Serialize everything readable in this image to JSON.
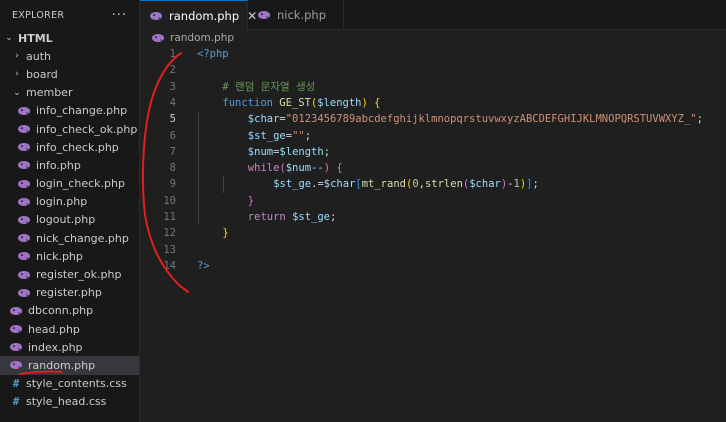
{
  "explorer": {
    "title": "EXPLORER",
    "more_label": "···"
  },
  "tree": [
    {
      "label": "HTML",
      "type": "root-folder",
      "chevron": "⌄"
    },
    {
      "label": "auth",
      "type": "folder",
      "chevron": "›"
    },
    {
      "label": "board",
      "type": "folder",
      "chevron": "›"
    },
    {
      "label": "member",
      "type": "folder",
      "chevron": "⌄"
    },
    {
      "label": "info_change.php",
      "type": "php"
    },
    {
      "label": "info_check_ok.php",
      "type": "php"
    },
    {
      "label": "info_check.php",
      "type": "php"
    },
    {
      "label": "info.php",
      "type": "php"
    },
    {
      "label": "login_check.php",
      "type": "php"
    },
    {
      "label": "login.php",
      "type": "php"
    },
    {
      "label": "logout.php",
      "type": "php"
    },
    {
      "label": "nick_change.php",
      "type": "php"
    },
    {
      "label": "nick.php",
      "type": "php"
    },
    {
      "label": "register_ok.php",
      "type": "php"
    },
    {
      "label": "register.php",
      "type": "php"
    },
    {
      "label": "dbconn.php",
      "type": "php"
    },
    {
      "label": "head.php",
      "type": "php"
    },
    {
      "label": "index.php",
      "type": "php"
    },
    {
      "label": "random.php",
      "type": "php",
      "selected": true
    },
    {
      "label": "style_contents.css",
      "type": "css"
    },
    {
      "label": "style_head.css",
      "type": "css"
    }
  ],
  "tabs": [
    {
      "label": "random.php",
      "active": true,
      "close": "✕"
    },
    {
      "label": "nick.php",
      "active": false
    }
  ],
  "breadcrumb": {
    "file": "random.php"
  },
  "editor": {
    "current_line": 5,
    "lines": [
      {
        "n": "1",
        "indent": 0,
        "tokens": [
          [
            "tag",
            "<?php"
          ]
        ]
      },
      {
        "n": "2",
        "indent": 0,
        "tokens": []
      },
      {
        "n": "3",
        "indent": 1,
        "tokens": [
          [
            "cm",
            "# 랜덤 문자열 생성"
          ]
        ]
      },
      {
        "n": "4",
        "indent": 1,
        "tokens": [
          [
            "kw",
            "function "
          ],
          [
            "fn",
            "GE_ST"
          ],
          [
            "b1",
            "("
          ],
          [
            "var",
            "$length"
          ],
          [
            "b1",
            ")"
          ],
          [
            "pn",
            " "
          ],
          [
            "b1",
            "{"
          ]
        ]
      },
      {
        "n": "5",
        "indent": 2,
        "tokens": [
          [
            "var",
            "$char"
          ],
          [
            "pn",
            "="
          ],
          [
            "str",
            "\"0123456789abcdefghijklmnopqrstuvwxyzABCDEFGHIJKLMNOPQRSTUVWXYZ_\""
          ],
          [
            "pn",
            ";"
          ]
        ]
      },
      {
        "n": "6",
        "indent": 2,
        "tokens": [
          [
            "var",
            "$st_ge"
          ],
          [
            "pn",
            "="
          ],
          [
            "str",
            "\"\""
          ],
          [
            "pn",
            ";"
          ]
        ]
      },
      {
        "n": "7",
        "indent": 2,
        "tokens": [
          [
            "var",
            "$num"
          ],
          [
            "pn",
            "="
          ],
          [
            "var",
            "$length"
          ],
          [
            "pn",
            ";"
          ]
        ]
      },
      {
        "n": "8",
        "indent": 2,
        "tokens": [
          [
            "ctrl",
            "while"
          ],
          [
            "b2",
            "("
          ],
          [
            "var",
            "$num"
          ],
          [
            "pn",
            "--"
          ],
          [
            "b2",
            ")"
          ],
          [
            "pn",
            " "
          ],
          [
            "b2",
            "{"
          ]
        ]
      },
      {
        "n": "9",
        "indent": 3,
        "tokens": [
          [
            "var",
            "$st_ge"
          ],
          [
            "pn",
            ".="
          ],
          [
            "var",
            "$char"
          ],
          [
            "b3",
            "["
          ],
          [
            "fn",
            "mt_rand"
          ],
          [
            "b1",
            "("
          ],
          [
            "num",
            "0"
          ],
          [
            "pn",
            ","
          ],
          [
            "fn",
            "strlen"
          ],
          [
            "b2",
            "("
          ],
          [
            "var",
            "$char"
          ],
          [
            "b2",
            ")"
          ],
          [
            "pn",
            "-"
          ],
          [
            "num",
            "1"
          ],
          [
            "b1",
            ")"
          ],
          [
            "b3",
            "]"
          ],
          [
            "pn",
            ";"
          ]
        ]
      },
      {
        "n": "10",
        "indent": 2,
        "tokens": [
          [
            "b2",
            "}"
          ]
        ]
      },
      {
        "n": "11",
        "indent": 2,
        "tokens": [
          [
            "ctrl",
            "return "
          ],
          [
            "var",
            "$st_ge"
          ],
          [
            "pn",
            ";"
          ]
        ]
      },
      {
        "n": "12",
        "indent": 1,
        "tokens": [
          [
            "b1",
            "}"
          ]
        ]
      },
      {
        "n": "13",
        "indent": 0,
        "tokens": []
      },
      {
        "n": "14",
        "indent": 0,
        "tokens": [
          [
            "tag",
            "?>"
          ]
        ]
      }
    ]
  },
  "colors": {
    "accent": "#0078d4",
    "php_icon": "#a074c4",
    "annotation": "#e0201e"
  },
  "icons": {
    "php": "php-elephant-icon",
    "css": "css-hash-icon",
    "folder_open": "chevron-down-icon",
    "folder_closed": "chevron-right-icon"
  }
}
